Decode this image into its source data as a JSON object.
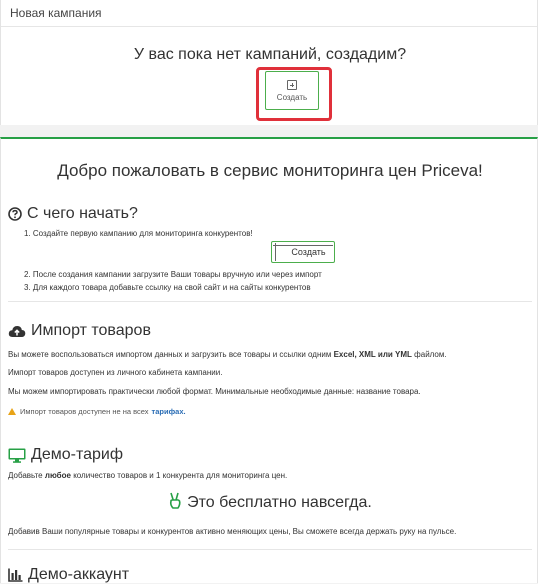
{
  "campaigns": {
    "header_title": "Новая кампания",
    "empty_message": "У вас пока нет кампаний, создадим?",
    "create_label": "Создать"
  },
  "welcome": {
    "title": "Добро пожаловать в сервис мониторинга цен Priceva!",
    "start": {
      "heading": "С чего начать?",
      "step1": "1. Создайте первую кампанию для мониторинга конкурентов!",
      "create_label": "Создать",
      "step2": "2. После создания кампании загрузите Ваши товары вручную или через импорт",
      "step3": "3. Для каждого товара добавьте ссылку на свой сайт и на сайты конкурентов"
    },
    "import": {
      "heading": "Импорт товаров",
      "p1_before": "Вы можете воспользоваться импортом данных и загрузить все товары и ссылки одним",
      "p1_formats": "Excel, XML или YML",
      "p1_after": "файлом.",
      "p2": "Импорт товаров доступен из личного кабинета кампании.",
      "p3": "Мы можем импортировать практически любой формат. Минимальные необходимые данные: название товара.",
      "note": "Импорт товаров доступен не на всех",
      "note_link": "тарифах."
    },
    "demo_tariff": {
      "heading": "Демо-тариф",
      "p1_before": "Добавьте",
      "p1_bold": "любое",
      "p1_after": "количество товаров и 1 конкурента для мониторинга цен.",
      "free_text": "Это бесплатно навсегда.",
      "p2": "Добавив Ваши популярные товары и конкурентов активно меняющих цены, Вы сможете всегда держать руку на пульсе."
    },
    "demo_account": {
      "heading": "Демо-аккаунт"
    }
  },
  "colors": {
    "accent_green": "#27a046",
    "highlight_red": "#e0303a",
    "link_blue": "#2a6db5",
    "warning_orange": "#e8a317"
  },
  "icons": {
    "start": "question-circle-icon",
    "import": "cloud-upload-icon",
    "demo_tariff": "monitor-icon",
    "free": "victory-hand-icon",
    "demo_account": "bar-chart-icon"
  }
}
